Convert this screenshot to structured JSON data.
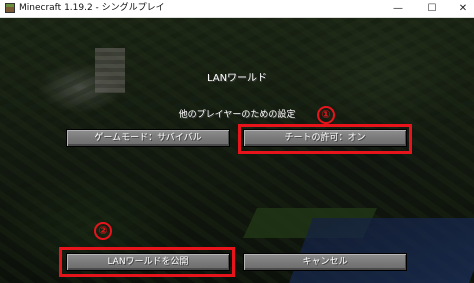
{
  "window": {
    "title": "Minecraft 1.19.2 - シングルプレイ",
    "minimize_glyph": "—",
    "maximize_glyph": "☐",
    "close_glyph": "✕",
    "icon": "minecraft-grass-block-icon"
  },
  "screen": {
    "title": "LANワールド",
    "section_label": "他のプレイヤーのための設定"
  },
  "buttons": {
    "game_mode": "ゲームモード：サバイバル",
    "allow_cheats": "チートの許可：オン",
    "open_lan": "LANワールドを公開",
    "cancel": "キャンセル"
  },
  "annotations": {
    "marker_1": "①",
    "marker_2": "②",
    "color": "#e8141c"
  }
}
